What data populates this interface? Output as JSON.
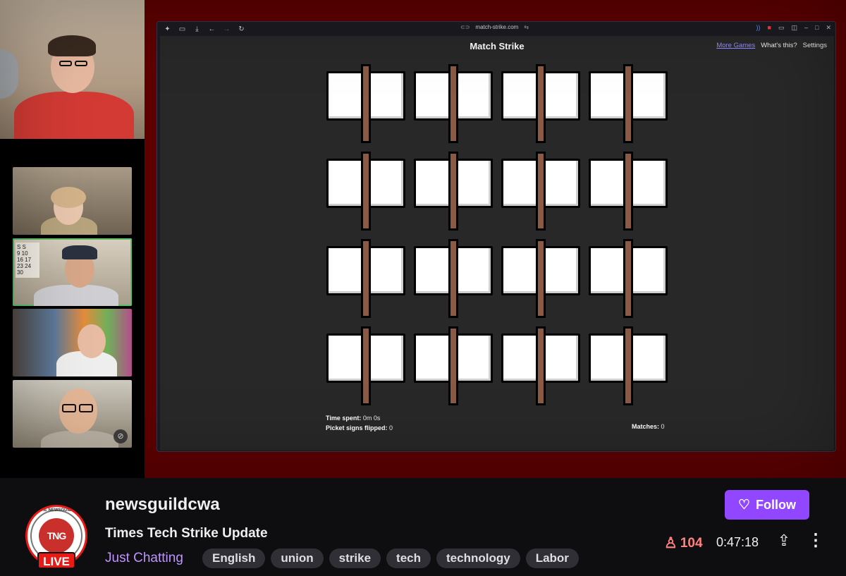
{
  "browser": {
    "url": "match-strike.com",
    "page_title": "Match Strike",
    "links": [
      "More Games",
      "What's this?",
      "Settings"
    ]
  },
  "game": {
    "time_spent_label": "Time spent:",
    "time_spent_value": "0m 0s",
    "flipped_label": "Picket signs flipped:",
    "flipped_value": "0",
    "matches_label": "Matches:",
    "matches_value": "0",
    "rows": 4,
    "cols": 4
  },
  "stream": {
    "channel": "newsguildcwa",
    "title": "Times Tech Strike Update",
    "category": "Just Chatting",
    "tags": [
      "English",
      "union",
      "strike",
      "tech",
      "technology",
      "Labor"
    ],
    "follow_label": "Follow",
    "viewers": "104",
    "uptime": "0:47:18",
    "live_label": "LIVE",
    "avatar_text": "TNG",
    "avatar_ring_text": "THE NEWSGUILD"
  },
  "icons": {
    "heart": "heart-icon",
    "viewer": "user-icon",
    "share": "share-icon",
    "more": "more-vertical-icon",
    "mute": "mic-off-icon"
  },
  "colors": {
    "accent": "#9147ff",
    "live": "#e91916",
    "category": "#bf94ff",
    "viewers": "#ff8280",
    "stream_bg": "#5e0000"
  }
}
